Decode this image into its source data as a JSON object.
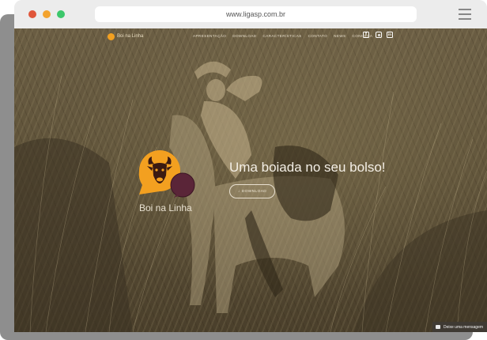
{
  "browser": {
    "url": "www.ligasp.com.br"
  },
  "nav": {
    "brand": "Boi na Linha",
    "links": [
      "APRESENTAÇÃO",
      "DOWNLOAD",
      "CARACTERÍSTICAS",
      "CONTATO",
      "NEWS",
      "CONHEÇA"
    ]
  },
  "hero": {
    "brand": "Boi na Linha",
    "headline": "Uma boiada no seu bolso!",
    "download_label": "DOWNLOAD"
  },
  "chat": {
    "label": "Deixe uma mensagem"
  },
  "colors": {
    "accent": "#f3a020",
    "bubble": "#5a2538",
    "overlay": "#5e5239"
  },
  "icons": [
    "facebook-icon",
    "instagram-icon",
    "linkedin-icon",
    "download-icon",
    "chat-icon",
    "menu-icon"
  ]
}
